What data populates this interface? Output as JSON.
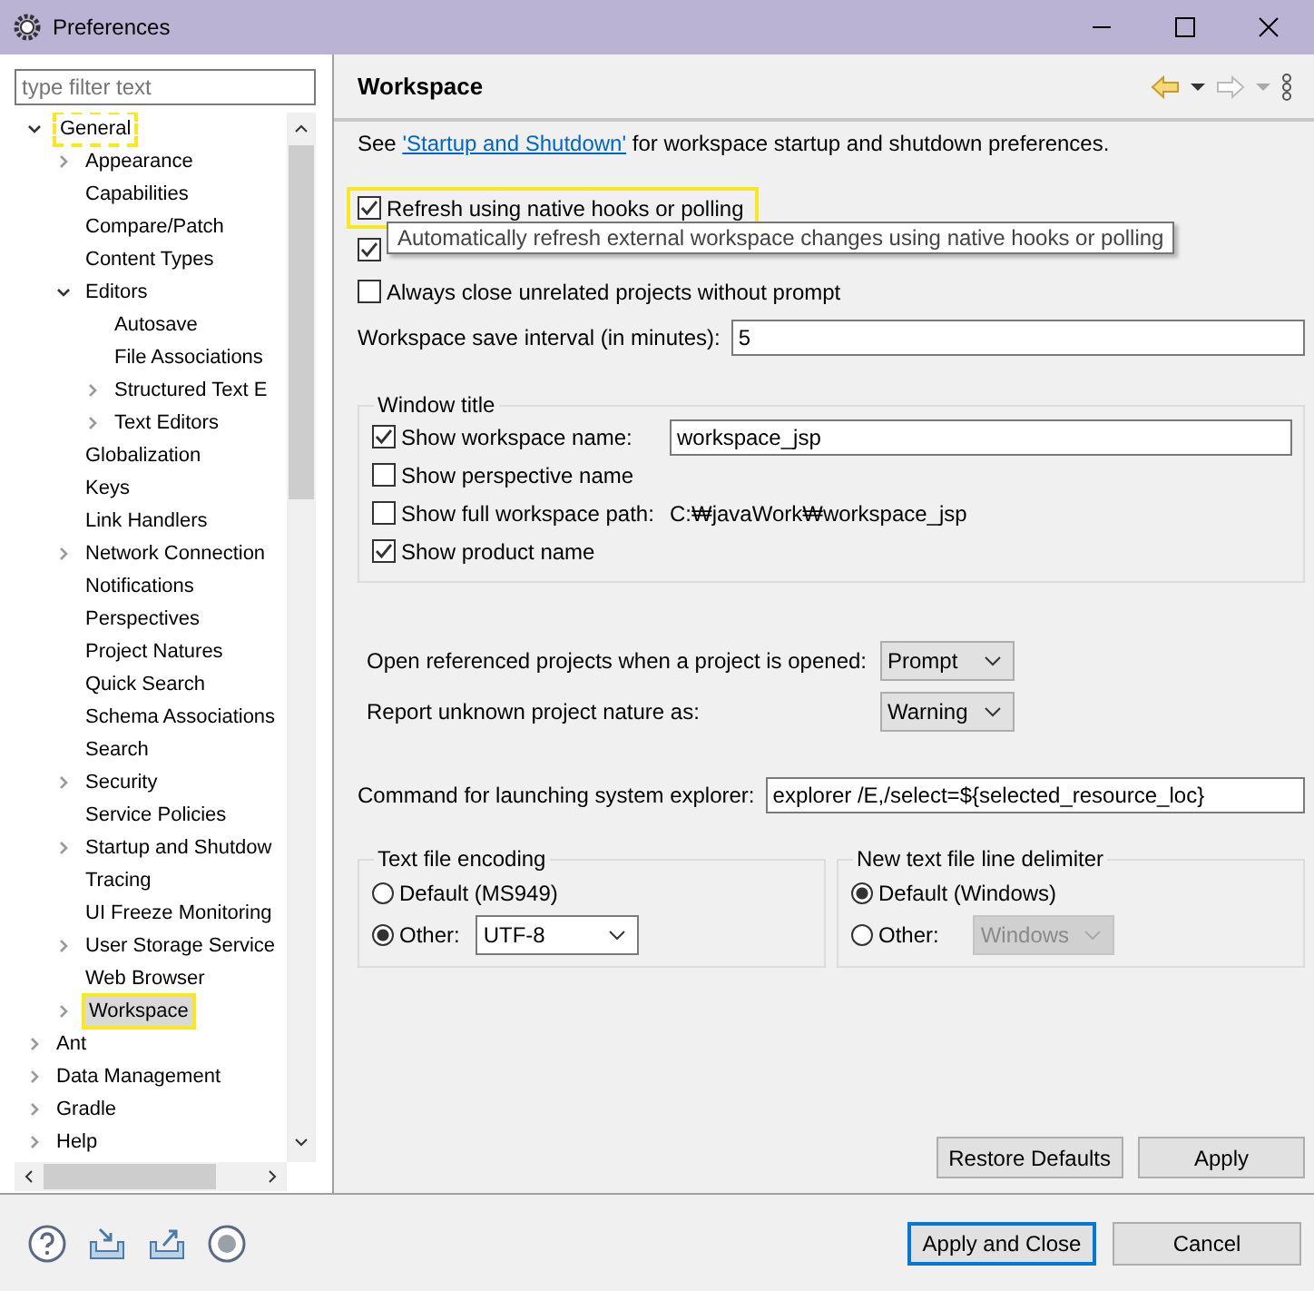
{
  "window": {
    "title": "Preferences"
  },
  "sidebar": {
    "filter": {
      "placeholder": "type filter text"
    },
    "tree": [
      {
        "label": "General",
        "expanded": true,
        "selected": false,
        "focused": true,
        "children": [
          {
            "label": "Appearance",
            "expanded": false,
            "selected": false
          },
          {
            "label": "Capabilities",
            "selected": false
          },
          {
            "label": "Compare/Patch",
            "selected": false
          },
          {
            "label": "Content Types",
            "selected": false
          },
          {
            "label": "Editors",
            "expanded": true,
            "selected": false,
            "children": [
              {
                "label": "Autosave",
                "selected": false
              },
              {
                "label": "File Associations",
                "selected": false
              },
              {
                "label": "Structured Text E",
                "expanded": false,
                "selected": false
              },
              {
                "label": "Text Editors",
                "expanded": false,
                "selected": false
              }
            ]
          },
          {
            "label": "Globalization",
            "selected": false
          },
          {
            "label": "Keys",
            "selected": false
          },
          {
            "label": "Link Handlers",
            "selected": false
          },
          {
            "label": "Network Connection",
            "expanded": false,
            "selected": false
          },
          {
            "label": "Notifications",
            "selected": false
          },
          {
            "label": "Perspectives",
            "selected": false
          },
          {
            "label": "Project Natures",
            "selected": false
          },
          {
            "label": "Quick Search",
            "selected": false
          },
          {
            "label": "Schema Associations",
            "selected": false
          },
          {
            "label": "Search",
            "selected": false
          },
          {
            "label": "Security",
            "expanded": false,
            "selected": false
          },
          {
            "label": "Service Policies",
            "selected": false
          },
          {
            "label": "Startup and Shutdow",
            "expanded": false,
            "selected": false
          },
          {
            "label": "Tracing",
            "selected": false
          },
          {
            "label": "UI Freeze Monitoring",
            "selected": false
          },
          {
            "label": "User Storage Service",
            "expanded": false,
            "selected": false
          },
          {
            "label": "Web Browser",
            "selected": false
          },
          {
            "label": "Workspace",
            "expanded": false,
            "selected": true,
            "highlighted": true
          }
        ]
      },
      {
        "label": "Ant",
        "expanded": false,
        "selected": false
      },
      {
        "label": "Data Management",
        "expanded": false,
        "selected": false
      },
      {
        "label": "Gradle",
        "expanded": false,
        "selected": false
      },
      {
        "label": "Help",
        "expanded": false,
        "selected": false
      }
    ]
  },
  "page": {
    "title": "Workspace",
    "intro": {
      "before": "See ",
      "link": "'Startup and Shutdown'",
      "after": " for workspace startup and shutdown preferences."
    },
    "options": [
      {
        "label": "Refresh using native hooks or polling",
        "checked": true,
        "highlighted": true
      },
      {
        "checked": true,
        "highlighted": false
      },
      {
        "label": "Always close unrelated projects without prompt",
        "checked": false,
        "highlighted": false
      }
    ],
    "tooltip": "Automatically refresh external workspace changes using native hooks or polling",
    "save_interval": {
      "label": "Workspace save interval (in minutes):",
      "value": "5"
    },
    "window_title": {
      "legend": "Window title",
      "options": [
        {
          "label": "Show workspace name:",
          "checked": true,
          "kind": "field",
          "value": "workspace_jsp"
        },
        {
          "label": "Show perspective name",
          "checked": false,
          "kind": "plain"
        },
        {
          "label": "Show full workspace path:",
          "checked": false,
          "kind": "text",
          "value": "C:₩javaWork₩workspace_jsp"
        },
        {
          "label": "Show product name",
          "checked": true,
          "kind": "plain"
        }
      ]
    },
    "dropdowns": [
      {
        "label": "Open referenced projects when a project is opened:",
        "value": "Prompt"
      },
      {
        "label": "Report unknown project nature as:",
        "value": "Warning"
      }
    ],
    "explorer": {
      "label": "Command for launching system explorer:",
      "value": "explorer /E,/select=${selected_resource_loc}"
    },
    "encoding": {
      "legend": "Text file encoding",
      "options": [
        {
          "label": "Default (MS949)",
          "selected": false
        },
        {
          "label": "Other:",
          "selected": true,
          "value": "UTF-8",
          "disabled": false
        }
      ]
    },
    "delimiter": {
      "legend": "New text file line delimiter",
      "options": [
        {
          "label": "Default (Windows)",
          "selected": true
        },
        {
          "label": "Other:",
          "selected": false,
          "value": "Windows",
          "disabled": true
        }
      ]
    },
    "page_buttons": [
      "Restore Defaults",
      "Apply"
    ]
  },
  "footer": {
    "buttons": [
      {
        "label": "Apply and Close",
        "default": true
      },
      {
        "label": "Cancel",
        "default": false
      }
    ]
  }
}
